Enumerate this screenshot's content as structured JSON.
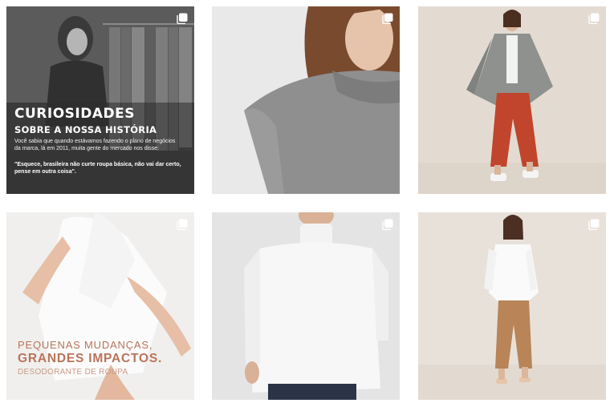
{
  "posts": [
    {
      "id_label": "post-1",
      "title": "CURIOSIDADES",
      "subtitle": "SOBRE A NOSSA HISTÓRIA",
      "body": "Você sabia que quando estávamos fazendo o plano de negócios da marca, lá em 2011, muita gente do mercado nos disse:",
      "quote": "\"Esquece, brasileira não curte roupa básica, não vai dar certo, pense em outra coisa\"."
    },
    {
      "id_label": "post-2"
    },
    {
      "id_label": "post-3"
    },
    {
      "id_label": "post-4",
      "line1": "PEQUENAS MUDANÇAS,",
      "line2": "GRANDES IMPACTOS.",
      "line3": "DESODORANTE DE ROUPA"
    },
    {
      "id_label": "post-5"
    },
    {
      "id_label": "post-6"
    }
  ],
  "icons": {
    "multiple_media": "multiple-images-icon"
  },
  "colors": {
    "accent_terracotta": "#b9735a",
    "overlay_dark": "#3c3c3c",
    "background": "#ffffff"
  }
}
